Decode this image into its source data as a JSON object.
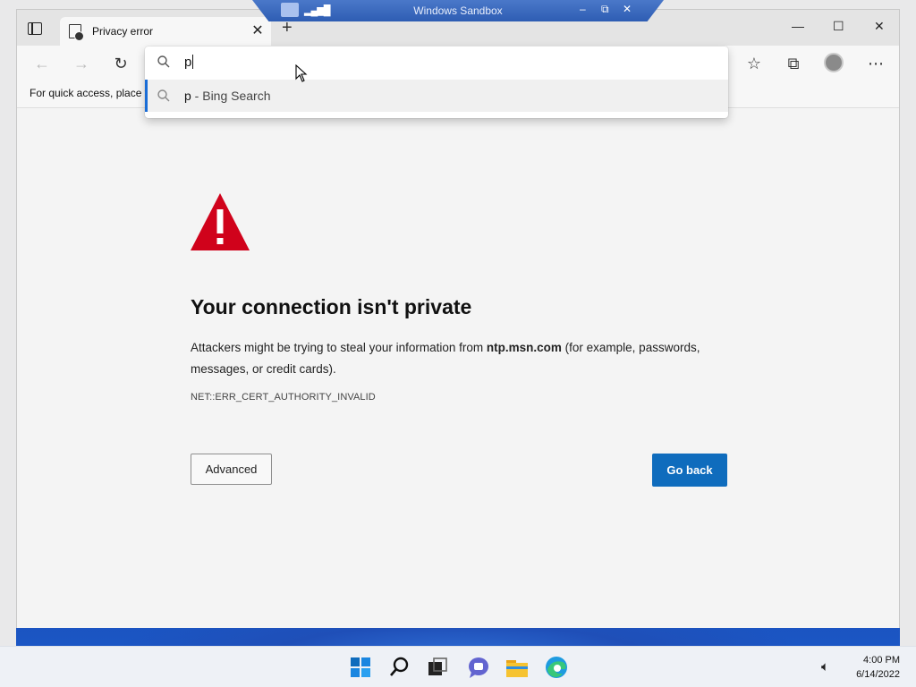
{
  "sandbox": {
    "title": "Windows Sandbox",
    "minimize": "–",
    "restore": "⧉",
    "close": "✕"
  },
  "browser": {
    "tab": {
      "title": "Privacy error",
      "close": "✕"
    },
    "new_tab": "+",
    "window_controls": {
      "minimize": "—",
      "maximize": "☐",
      "close": "✕"
    },
    "toolbar": {
      "back": "←",
      "forward": "→",
      "refresh": "↻",
      "favorites": "☆",
      "collections": "⧉",
      "more": "⋯"
    },
    "favorites_bar_text": "For quick access, place y",
    "omnibox": {
      "query": "p",
      "suggestion_query": "p",
      "suggestion_suffix": " - Bing Search"
    }
  },
  "error_page": {
    "title": "Your connection isn't private",
    "message_before": "Attackers might be trying to steal your information from ",
    "host": "ntp.msn.com",
    "message_after": " (for example, passwords, messages, or credit cards).",
    "error_code": "NET::ERR_CERT_AUTHORITY_INVALID",
    "advanced_label": "Advanced",
    "go_back_label": "Go back",
    "warning_color": "#d0021b",
    "accent_color": "#0f6cbd"
  },
  "taskbar": {
    "apps": [
      "windows-start-icon",
      "search-icon",
      "task-view-icon",
      "teams-chat-icon",
      "file-explorer-icon",
      "edge-icon"
    ],
    "time": "4:00 PM",
    "date": "6/14/2022"
  }
}
